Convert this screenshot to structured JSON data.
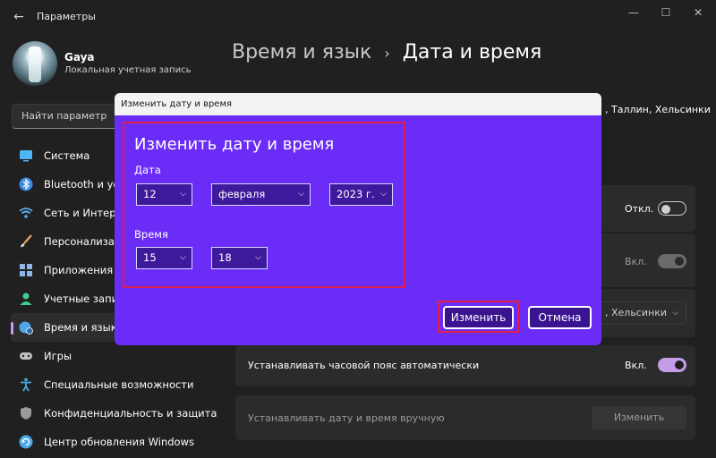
{
  "app": {
    "title": "Параметры",
    "back_glyph": "←",
    "minimize_glyph": "—",
    "maximize_glyph": "☐",
    "close_glyph": "✕"
  },
  "user": {
    "name": "Gaya",
    "account_type": "Локальная учетная запись"
  },
  "search": {
    "placeholder": "Найти параметр"
  },
  "sidebar": {
    "items": [
      {
        "label": "Система",
        "icon": "monitor-icon",
        "color": "#4fb6f5"
      },
      {
        "label": "Bluetooth и устр",
        "icon": "bluetooth-icon",
        "color": "#3b8de0"
      },
      {
        "label": "Сеть и Интерне",
        "icon": "wifi-icon",
        "color": "#58b4f0"
      },
      {
        "label": "Персонализаци",
        "icon": "brush-icon",
        "color": "#e6a15a"
      },
      {
        "label": "Приложения",
        "icon": "apps-icon",
        "color": "#8fb6e6"
      },
      {
        "label": "Учетные запис",
        "icon": "person-icon",
        "color": "#3fcf8e"
      },
      {
        "label": "Время и язык",
        "icon": "globe-clock-icon",
        "color": "#4da8e8",
        "active": true
      },
      {
        "label": "Игры",
        "icon": "gamepad-icon",
        "color": "#c0c0c0"
      },
      {
        "label": "Специальные возможности",
        "icon": "accessibility-icon",
        "color": "#4da8e8"
      },
      {
        "label": "Конфиденциальность и защита",
        "icon": "shield-icon",
        "color": "#9a9a9a"
      },
      {
        "label": "Центр обновления Windows",
        "icon": "update-icon",
        "color": "#4da8e8"
      }
    ]
  },
  "breadcrumb": {
    "parent": "Время и язык",
    "separator": "›",
    "current": "Дата и время"
  },
  "background": {
    "timezone_partial": ", Таллин, Хельсинки",
    "card1_toggle_label": "Откл.",
    "card2_toggle_label": "Вкл.",
    "timezone_dropdown_partial": ", Хельсинки",
    "auto_timezone_label": "Устанавливать часовой пояс автоматически",
    "auto_timezone_toggle_label": "Вкл.",
    "manual_label": "Устанавливать дату и время вручную",
    "manual_button": "Изменить"
  },
  "dialog": {
    "window_title": "Изменить дату и время",
    "heading": "Изменить дату и время",
    "date_label": "Дата",
    "day": "12",
    "month": "февраля",
    "year": "2023 г.",
    "time_label": "Время",
    "hour": "15",
    "minute": "18",
    "chevron": "⌵",
    "change_button": "Изменить",
    "cancel_button": "Отмена"
  },
  "colors": {
    "accent": "#c59ce8",
    "dialog_bg": "#6a2cf6",
    "highlight_border": "#e0204a",
    "window_bg": "#202020"
  }
}
